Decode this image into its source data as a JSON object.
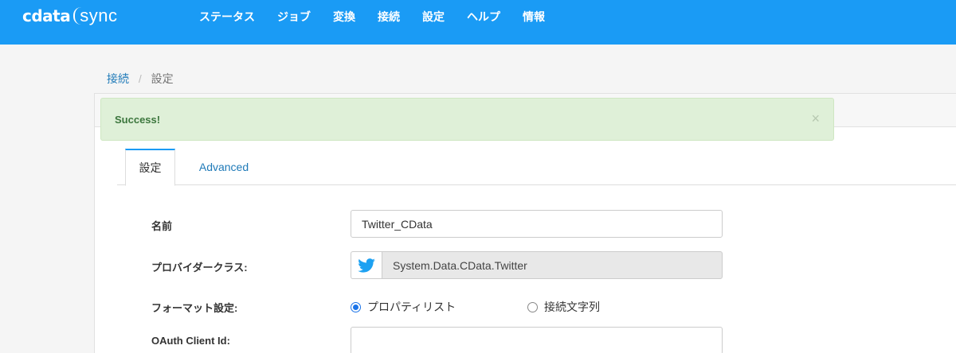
{
  "header": {
    "logo_brand": "cdata",
    "logo_product": "sync",
    "nav": [
      "ステータス",
      "ジョブ",
      "変換",
      "接続",
      "設定",
      "ヘルプ",
      "情報"
    ]
  },
  "breadcrumb": {
    "parent": "接続",
    "separator": "/",
    "current": "設定"
  },
  "alert": {
    "text": "Success!",
    "close": "×"
  },
  "tabs": {
    "settings": "設定",
    "advanced": "Advanced"
  },
  "form": {
    "name_label": "名前",
    "name_value": "Twitter_CData",
    "provider_label": "プロバイダークラス:",
    "provider_icon": "twitter-bird-icon",
    "provider_value": "System.Data.CData.Twitter",
    "format_label": "フォーマット設定:",
    "format_options": [
      "プロパティリスト",
      "接続文字列"
    ],
    "format_selected": "プロパティリスト",
    "oauth_label": "OAuth Client Id:",
    "oauth_value": ""
  },
  "colors": {
    "topbar": "#1a9bf5",
    "alert_bg": "#dff0d8",
    "alert_text": "#3c763d",
    "link": "#1f7ab8"
  }
}
